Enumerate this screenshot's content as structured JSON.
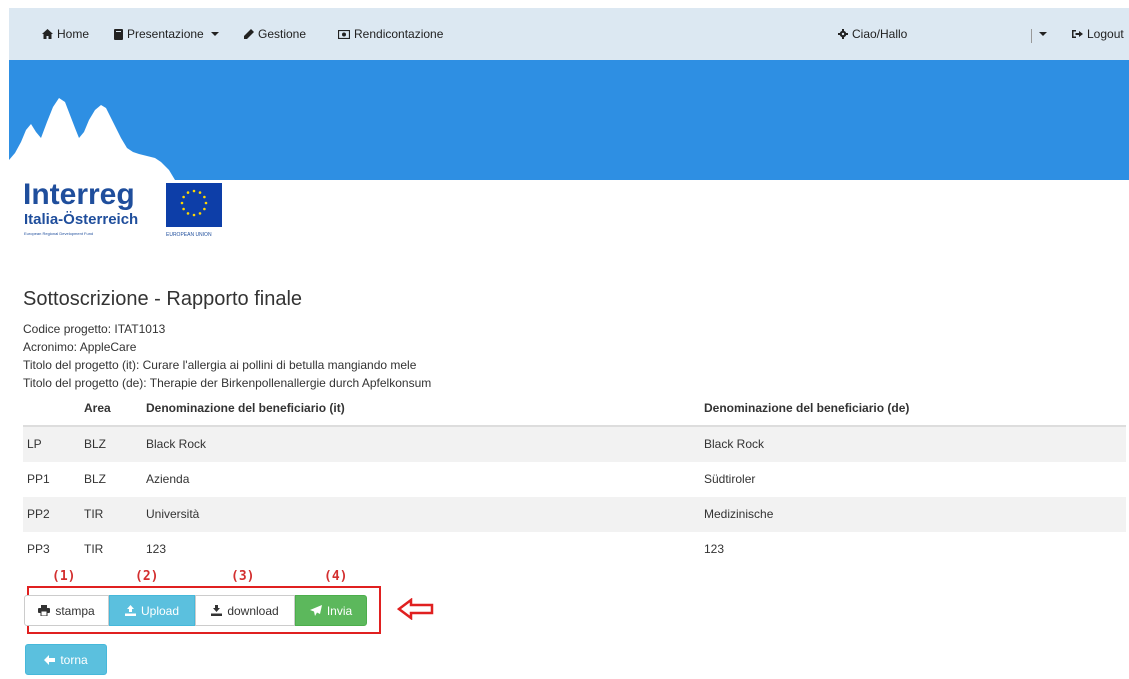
{
  "nav": {
    "home": "Home",
    "presentazione": "Presentazione",
    "gestione": "Gestione",
    "rendicontazione": "Rendicontazione",
    "user": "Ciao/Hallo",
    "logout": "Logout"
  },
  "logo": {
    "word": "Interreg",
    "subtitle": "Italia-Österreich",
    "fund": "European Regional Development Fund",
    "eu_label": "EUROPEAN UNION"
  },
  "page_title": "Sottoscrizione - Rapporto finale",
  "info": {
    "codice": "Codice progetto: ITAT1013",
    "acronimo": "Acronimo: AppleCare",
    "titolo_it": "Titolo del progetto (it): Curare l'allergia ai pollini di betulla mangiando mele",
    "titolo_de": "Titolo del progetto (de): Therapie der Birkenpollenallergie durch Apfelkonsum"
  },
  "table": {
    "headers": [
      "",
      "Area",
      "Denominazione del beneficiario (it)",
      "Denominazione del beneficiario (de)"
    ],
    "rows": [
      {
        "role": "LP",
        "area": "BLZ",
        "name_it": "Black Rock",
        "name_de": "Black Rock"
      },
      {
        "role": "PP1",
        "area": "BLZ",
        "name_it": "Azienda",
        "name_de": "Südtiroler"
      },
      {
        "role": "PP2",
        "area": "TIR",
        "name_it": "Università",
        "name_de": "Medizinische"
      },
      {
        "role": "PP3",
        "area": "TIR",
        "name_it": "123",
        "name_de": "123"
      }
    ]
  },
  "annotations": [
    "(1)",
    "(2)",
    "(3)",
    "(4)"
  ],
  "buttons": {
    "stampa": "stampa",
    "upload": "Upload",
    "download": "download",
    "invia": "Invia",
    "torna": "torna"
  },
  "colors": {
    "navbar": "#dce8f2",
    "banner": "#2e8fe3",
    "info_button": "#5bc0de",
    "success_button": "#5cb85c",
    "annotation_red": "#e02020",
    "logo_blue": "#1f4e9c",
    "eu_blue": "#0d3ea8"
  }
}
